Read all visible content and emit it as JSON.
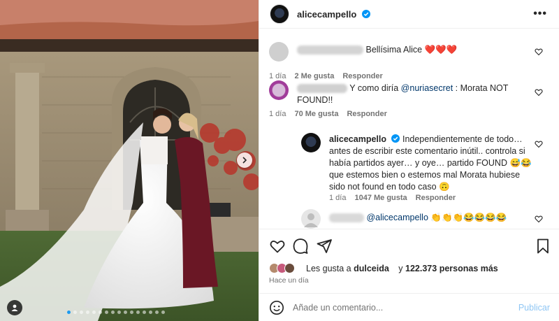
{
  "post": {
    "username": "alicecampello",
    "more_label": "•••"
  },
  "carousel": {
    "dot_count": 16,
    "active_index": 0
  },
  "comments": [
    {
      "text": "Bellísima Alice ❤️❤️❤️",
      "time": "1 día",
      "likes": "2 Me gusta",
      "reply": "Responder"
    },
    {
      "text_before": "Y como diría ",
      "mention": "@nuriasecret",
      "text_after": " : Morata NOT FOUND!!",
      "time": "1 día",
      "likes": "70 Me gusta",
      "reply": "Responder"
    },
    {
      "username": "alicecampello",
      "text": "Independientemente de todo…antes de escribir este comentario inútil.. controla si había partidos ayer… y oye… partido FOUND 😅😂 que estemos bien o estemos mal Morata hubiese sido not found en todo caso 🙃",
      "time": "1 día",
      "likes": "1047 Me gusta",
      "reply": "Responder"
    },
    {
      "mention": "@alicecampello",
      "text": "👏👏👏😂😂😂😂"
    }
  ],
  "likes_summary": {
    "prefix": "Les gusta a ",
    "user": "dulceida",
    "middle": " y ",
    "count": "122.373 personas más"
  },
  "posted_ago": "Hace un día",
  "composer": {
    "placeholder": "Añade un comentario...",
    "post_label": "Publicar"
  },
  "colors": {
    "accent": "#0095f6",
    "verified": "#0095f6",
    "heart": "#ed1c24"
  }
}
